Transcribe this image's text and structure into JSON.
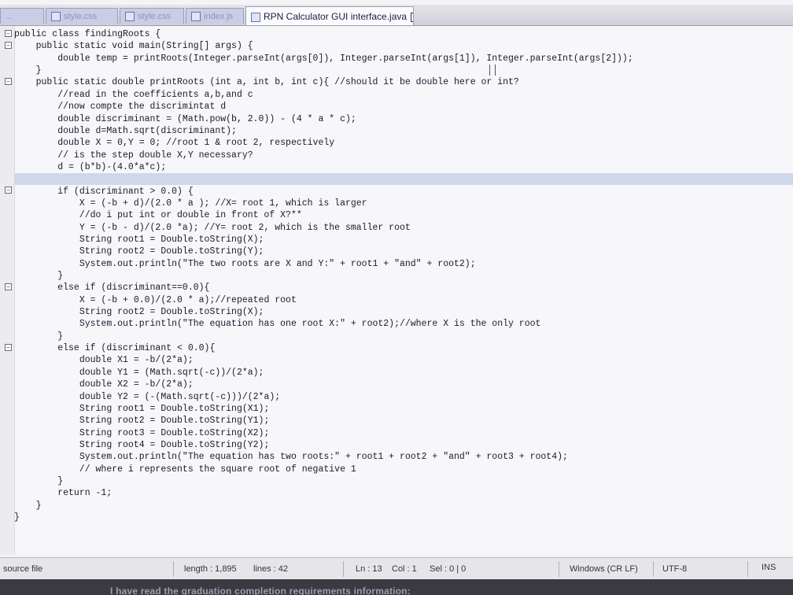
{
  "tabs": [
    {
      "label": "...",
      "active": false
    },
    {
      "label": "style.css",
      "active": false
    },
    {
      "label": "style.css",
      "active": false
    },
    {
      "label": "index.js",
      "active": false
    },
    {
      "label": "RPN Calculator GUI interface.java",
      "active": true
    }
  ],
  "code_lines": [
    "public class findingRoots {",
    "    public static void main(String[] args) {",
    "        double temp = printRoots(Integer.parseInt(args[0]), Integer.parseInt(args[1]), Integer.parseInt(args[2]));",
    "    }",
    "    public static double printRoots (int a, int b, int c){ //should it be double here or int?",
    "        //read in the coefficients a,b,and c",
    "        //now compte the discrimintat d",
    "        double discriminant = (Math.pow(b, 2.0)) - (4 * a * c);",
    "        double d=Math.sqrt(discriminant);",
    "        double X = 0,Y = 0; //root 1 & root 2, respectively",
    "        // is the step double X,Y necessary?",
    "        d = (b*b)-(4.0*a*c);",
    "",
    "        if (discriminant > 0.0) {",
    "            X = (-b + d)/(2.0 * a ); //X= root 1, which is larger",
    "            //do i put int or double in front of X?**",
    "            Y = (-b - d)/(2.0 *a); //Y= root 2, which is the smaller root",
    "            String root1 = Double.toString(X);",
    "            String root2 = Double.toString(Y);",
    "            System.out.println(\"The two roots are X and Y:\" + root1 + \"and\" + root2);",
    "        }",
    "        else if (discriminant==0.0){",
    "            X = (-b + 0.0)/(2.0 * a);//repeated root",
    "            String root2 = Double.toString(X);",
    "            System.out.println(\"The equation has one root X:\" + root2);//where X is the only root",
    "        }",
    "        else if (discriminant < 0.0){",
    "            double X1 = -b/(2*a);",
    "            double Y1 = (Math.sqrt(-c))/(2*a);",
    "            double X2 = -b/(2*a);",
    "            double Y2 = (-(Math.sqrt(-c)))/(2*a);",
    "            String root1 = Double.toString(X1);",
    "            String root2 = Double.toString(Y1);",
    "            String root3 = Double.toString(X2);",
    "            String root4 = Double.toString(Y2);",
    "            System.out.println(\"The equation has two roots:\" + root1 + root2 + \"and\" + root3 + root4);",
    "            // where i represents the square root of negative 1",
    "        }",
    "        return -1;",
    "    }",
    "}"
  ],
  "current_line_index": 12,
  "status": {
    "file_type": "source file",
    "length": "length : 1,895",
    "lines": "lines : 42",
    "ln": "Ln : 13",
    "col": "Col : 1",
    "sel": "Sel : 0 | 0",
    "eol": "Windows (CR LF)",
    "encoding": "UTF-8",
    "mode": "INS"
  },
  "bottom_text": "I have read the graduation completion requirements information:"
}
